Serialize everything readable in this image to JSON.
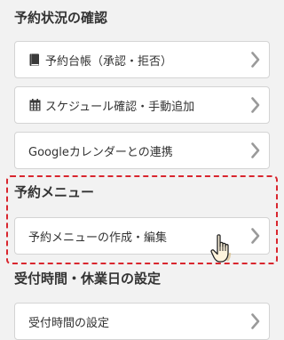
{
  "sections": [
    {
      "title": "予約状況の確認",
      "items": [
        {
          "label": "予約台帳（承認・拒否）",
          "icon": "book-icon"
        },
        {
          "label": "スケジュール確認・手動追加",
          "icon": "calendar-icon"
        },
        {
          "label": "Googleカレンダーとの連携",
          "icon": ""
        }
      ]
    },
    {
      "title": "予約メニュー",
      "items": [
        {
          "label": "予約メニューの作成・編集",
          "icon": ""
        }
      ]
    },
    {
      "title": "受付時間・休業日の設定",
      "items": [
        {
          "label": "受付時間の設定",
          "icon": ""
        }
      ]
    }
  ],
  "colors": {
    "highlight": "#d9262e",
    "chevron": "#9a9a9a",
    "background": "#f2f2f2"
  }
}
